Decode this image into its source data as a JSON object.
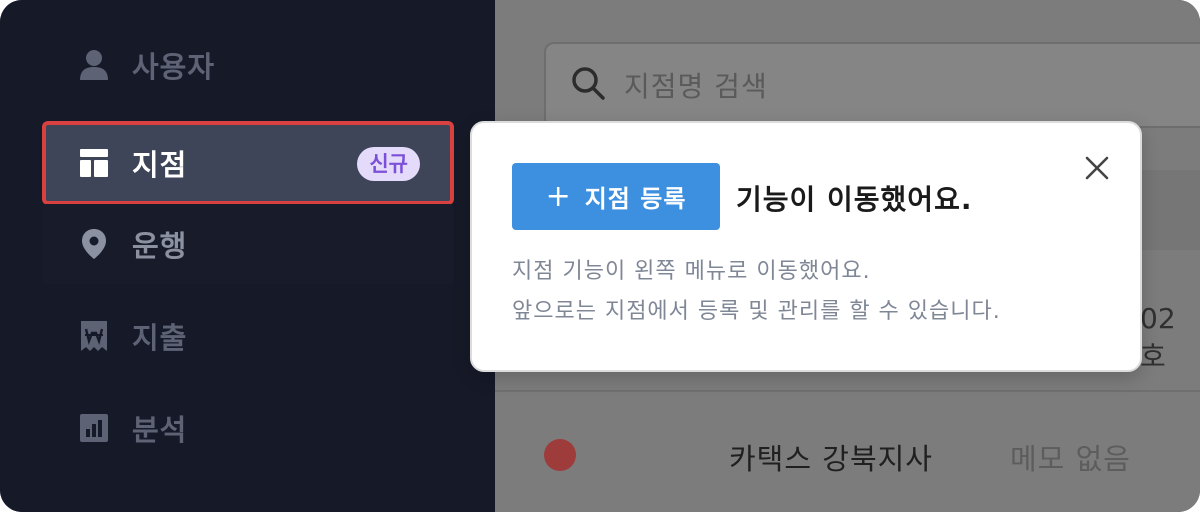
{
  "sidebar": {
    "items": [
      {
        "label": "사용자",
        "icon": "user-icon"
      },
      {
        "label": "지점",
        "icon": "layout-icon",
        "badge": "신규"
      },
      {
        "label": "운행",
        "icon": "map-pin-icon"
      },
      {
        "label": "지출",
        "icon": "receipt-icon"
      },
      {
        "label": "분석",
        "icon": "chart-icon"
      }
    ]
  },
  "main": {
    "search": {
      "placeholder": "지점명 검색"
    },
    "row_fragment": "02호",
    "rows": [
      {
        "name": "카택스 강북지사",
        "memo": "메모 없음",
        "status_color": "#c24848"
      }
    ]
  },
  "popover": {
    "button_plus": "+",
    "button_label": "지점 등록",
    "headline": "기능이 이동했어요.",
    "desc_line1": "지점 기능이 왼쪽 메뉴로 이동했어요.",
    "desc_line2": "앞으로는 지점에서 등록 및 관리를 할 수 있습니다."
  },
  "colors": {
    "sidebar_bg": "#161a28",
    "active_item_bg": "#3f4558",
    "highlight_border": "#d94140",
    "badge_bg": "#e4dbfb",
    "badge_text": "#7b4fd8",
    "button_blue": "#3d8fdf"
  }
}
